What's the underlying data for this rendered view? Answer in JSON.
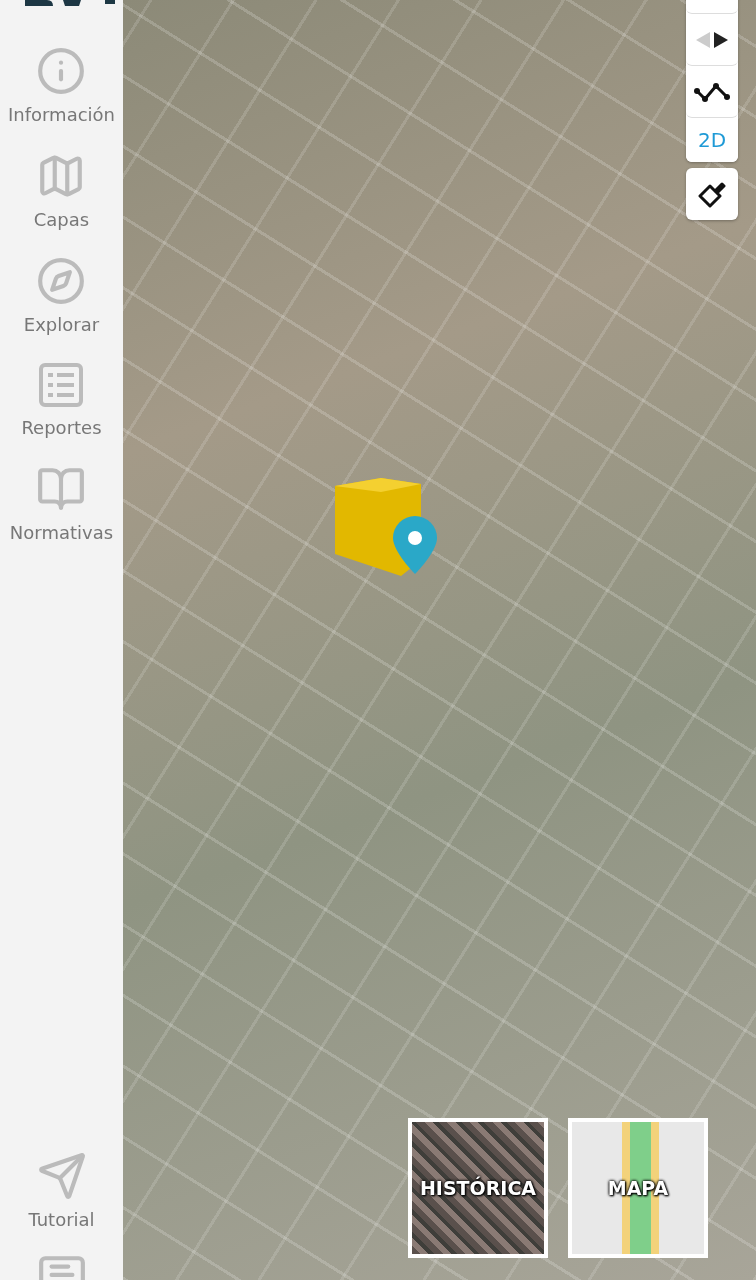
{
  "sidebar": {
    "items": [
      {
        "kind": "info",
        "label": "Información"
      },
      {
        "kind": "map",
        "label": "Capas"
      },
      {
        "kind": "compass",
        "label": "Explorar"
      },
      {
        "kind": "list",
        "label": "Reportes"
      },
      {
        "kind": "book",
        "label": "Normativas"
      }
    ],
    "bottom_items": [
      {
        "kind": "send",
        "label": "Tutorial"
      },
      {
        "kind": "chat"
      }
    ]
  },
  "map_controls": {
    "view_toggle": "2D"
  },
  "base_layers": [
    {
      "kind": "aerial",
      "label": "HISTÓRICA"
    },
    {
      "kind": "street",
      "label": "MAPA"
    }
  ]
}
